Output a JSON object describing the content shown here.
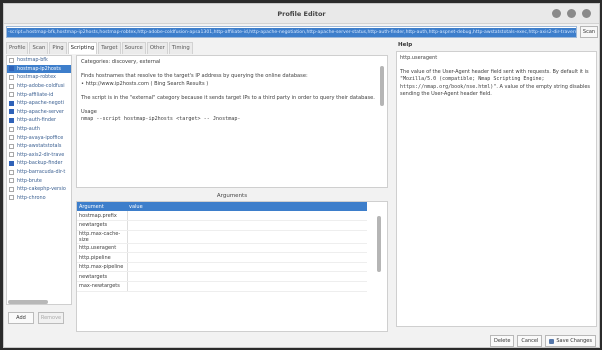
{
  "window": {
    "title": "Profile Editor"
  },
  "command": {
    "value": "-script=hostmap-bfk,hostmap-ip2hosts,hostmap-robtex,http-adobe-coldfusion-apsa1301,http-affiliate-id,http-apache-negotiation,http-apache-server-status,http-auth-finder,http-auth,http-aspnet-debug,http-awstatstotals-exec,http-axis2-dir-traversal,http-backup-finder,http-barracuda-dir-traversal,http-bigip-cookie,http-brute,http-cakephp-version,http-chrono -v",
    "scan_label": "Scan"
  },
  "tabs": [
    {
      "label": "Profile",
      "active": false
    },
    {
      "label": "Scan",
      "active": false
    },
    {
      "label": "Ping",
      "active": false
    },
    {
      "label": "Scripting",
      "active": true
    },
    {
      "label": "Target",
      "active": false
    },
    {
      "label": "Source",
      "active": false
    },
    {
      "label": "Other",
      "active": false
    },
    {
      "label": "Timing",
      "active": false
    }
  ],
  "scripts": [
    {
      "name": "hostmap-bfk",
      "checked": false,
      "selected": false
    },
    {
      "name": "hostmap-ip2hosts",
      "checked": true,
      "selected": true
    },
    {
      "name": "hostmap-robtex",
      "checked": false,
      "selected": false
    },
    {
      "name": "http-adobe-coldfusi",
      "checked": false,
      "selected": false
    },
    {
      "name": "http-affiliate-id",
      "checked": false,
      "selected": false
    },
    {
      "name": "http-apache-negoti",
      "checked": true,
      "selected": false
    },
    {
      "name": "http-apache-server",
      "checked": true,
      "selected": false
    },
    {
      "name": "http-auth-finder",
      "checked": true,
      "selected": false
    },
    {
      "name": "http-auth",
      "checked": false,
      "selected": false
    },
    {
      "name": "http-avaya-ipoffice",
      "checked": false,
      "selected": false
    },
    {
      "name": "http-awstatstotals",
      "checked": false,
      "selected": false
    },
    {
      "name": "http-axis2-dir-trave",
      "checked": false,
      "selected": false
    },
    {
      "name": "http-backup-finder",
      "checked": true,
      "selected": false
    },
    {
      "name": "http-barracuda-dir-t",
      "checked": false,
      "selected": false
    },
    {
      "name": "http-brute",
      "checked": false,
      "selected": false
    },
    {
      "name": "http-cakephp-versio",
      "checked": false,
      "selected": false
    },
    {
      "name": "http-chrono",
      "checked": false,
      "selected": false
    }
  ],
  "list_buttons": {
    "add": "Add",
    "remove": "Remove"
  },
  "description": {
    "categories": "Categories: discovery, external",
    "para1": "Finds hostnames that resolve to the target's IP address by querying the online database:",
    "bullet": "• http://www.ip2hosts.com ( Bing Search Results )",
    "para2": "The script is in the \"external\" category because it sends target IPs to a third party in order to query their database.",
    "usage_label": "Usage",
    "usage_code": "nmap --script hostmap-ip2hosts <target> -- Jnostmap-"
  },
  "arguments": {
    "title": "Arguments",
    "col_argument": "Argument",
    "col_value": "value",
    "rows": [
      "hostmap.prefix",
      "newtargets",
      "http.max-cache-size",
      "http.useragent",
      "http.pipeline",
      "http.max-pipeline",
      "newtargets",
      "max-newtargets"
    ]
  },
  "help": {
    "label": "Help",
    "name": "http.useragent",
    "text_before": "The value of the User-Agent header field sent with requests. By default it is ",
    "default_value": "\"Mozilla/5.0 (compatible; Nmap Scripting Engine; https://nmap.org/book/nse.html)\"",
    "text_after": ". A value of the empty string disables sending the User-Agent header field."
  },
  "bottom_buttons": {
    "delete": "Delete",
    "cancel": "Cancel",
    "save": "Save Changes"
  }
}
